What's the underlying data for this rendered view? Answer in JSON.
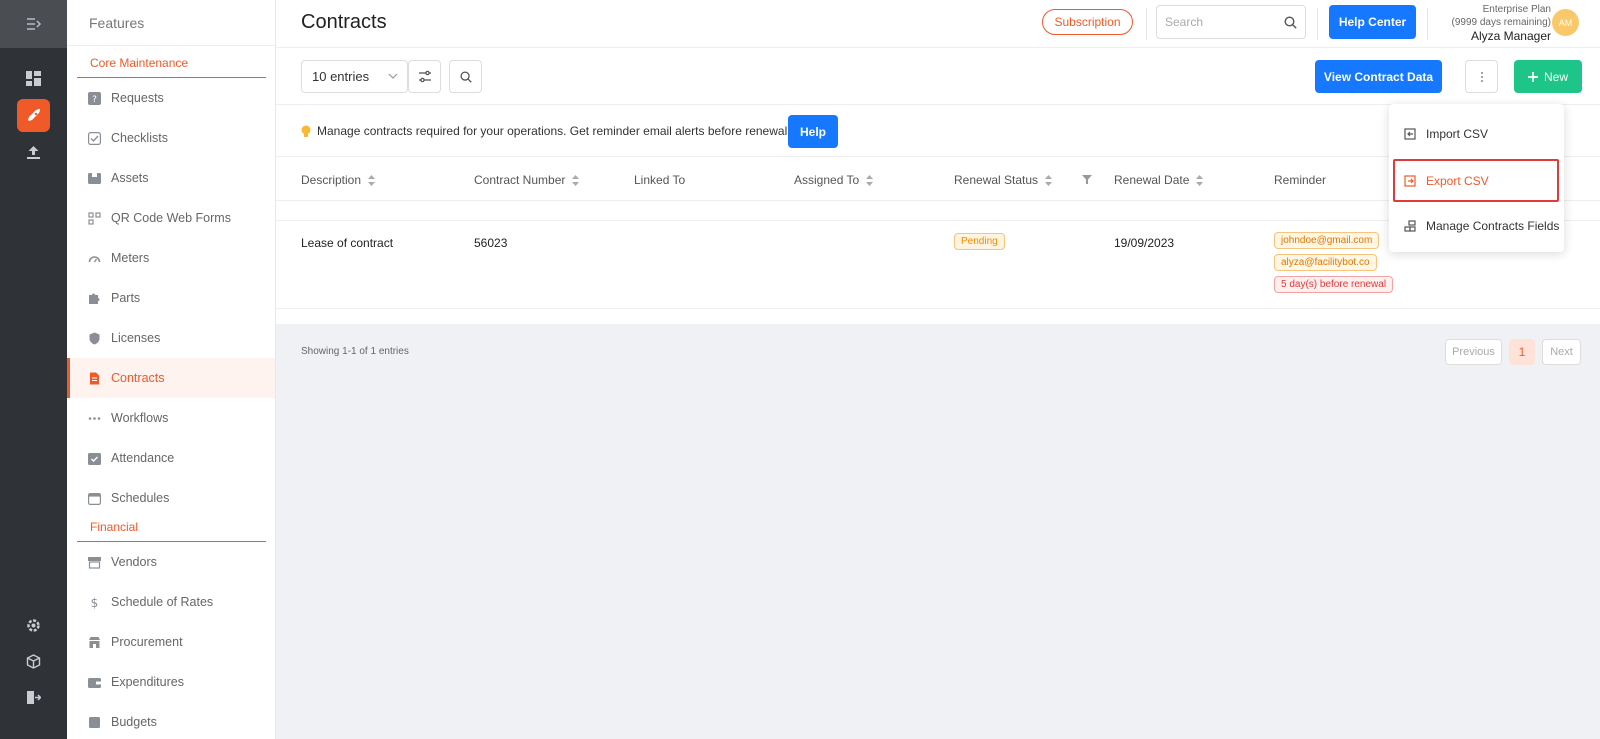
{
  "sidebar": {
    "title": "Features",
    "sections": [
      "Core Maintenance",
      "Financial"
    ],
    "items_core": [
      {
        "label": "Requests",
        "icon": "question-icon"
      },
      {
        "label": "Checklists",
        "icon": "checklist-icon"
      },
      {
        "label": "Assets",
        "icon": "box-icon"
      },
      {
        "label": "QR Code Web Forms",
        "icon": "qr-icon"
      },
      {
        "label": "Meters",
        "icon": "gauge-icon"
      },
      {
        "label": "Parts",
        "icon": "puzzle-icon"
      },
      {
        "label": "Licenses",
        "icon": "shield-icon"
      },
      {
        "label": "Contracts",
        "icon": "contract-icon"
      },
      {
        "label": "Workflows",
        "icon": "dots-icon"
      },
      {
        "label": "Attendance",
        "icon": "attendance-icon"
      },
      {
        "label": "Schedules",
        "icon": "calendar-icon"
      }
    ],
    "items_financial": [
      {
        "label": "Vendors",
        "icon": "store-icon"
      },
      {
        "label": "Schedule of Rates",
        "icon": "dollar-icon"
      },
      {
        "label": "Procurement",
        "icon": "shop-icon"
      },
      {
        "label": "Expenditures",
        "icon": "wallet-icon"
      },
      {
        "label": "Budgets",
        "icon": "budget-icon"
      }
    ],
    "active": "Contracts"
  },
  "header": {
    "title": "Contracts",
    "subscription": "Subscription",
    "search_placeholder": "Search",
    "help_center": "Help Center",
    "plan": "Enterprise Plan",
    "days": "(9999 days remaining)",
    "user": "Alyza Manager",
    "avatar": "AM"
  },
  "toolbar": {
    "entries": "10 entries",
    "view_contract_data": "View Contract Data",
    "new": "New"
  },
  "info": {
    "text": "Manage contracts required for your operations. Get reminder email alerts before renewal",
    "help": "Help"
  },
  "table": {
    "headers": [
      "Description",
      "Contract Number",
      "Linked To",
      "Assigned To",
      "Renewal Status",
      "Renewal Date",
      "Reminder"
    ],
    "rows": [
      {
        "description": "Lease of contract",
        "contract_number": "56023",
        "linked_to": "",
        "assigned_to": "",
        "renewal_status": "Pending",
        "renewal_date": "19/09/2023",
        "reminder_emails": [
          "johndoe@gmail.com",
          "alyza@facilitybot.co"
        ],
        "reminder_when": "5 day(s) before renewal"
      }
    ]
  },
  "footer": {
    "showing": "Showing 1-1 of 1 entries",
    "previous": "Previous",
    "page": "1",
    "next": "Next"
  },
  "menu": {
    "items": [
      "Import CSV",
      "Export CSV",
      "Manage Contracts Fields"
    ],
    "highlighted": "Export CSV"
  },
  "colors": {
    "accent": "#f05a28",
    "primary": "#1677ff",
    "success": "#1dc589",
    "rail": "#2f3338"
  }
}
